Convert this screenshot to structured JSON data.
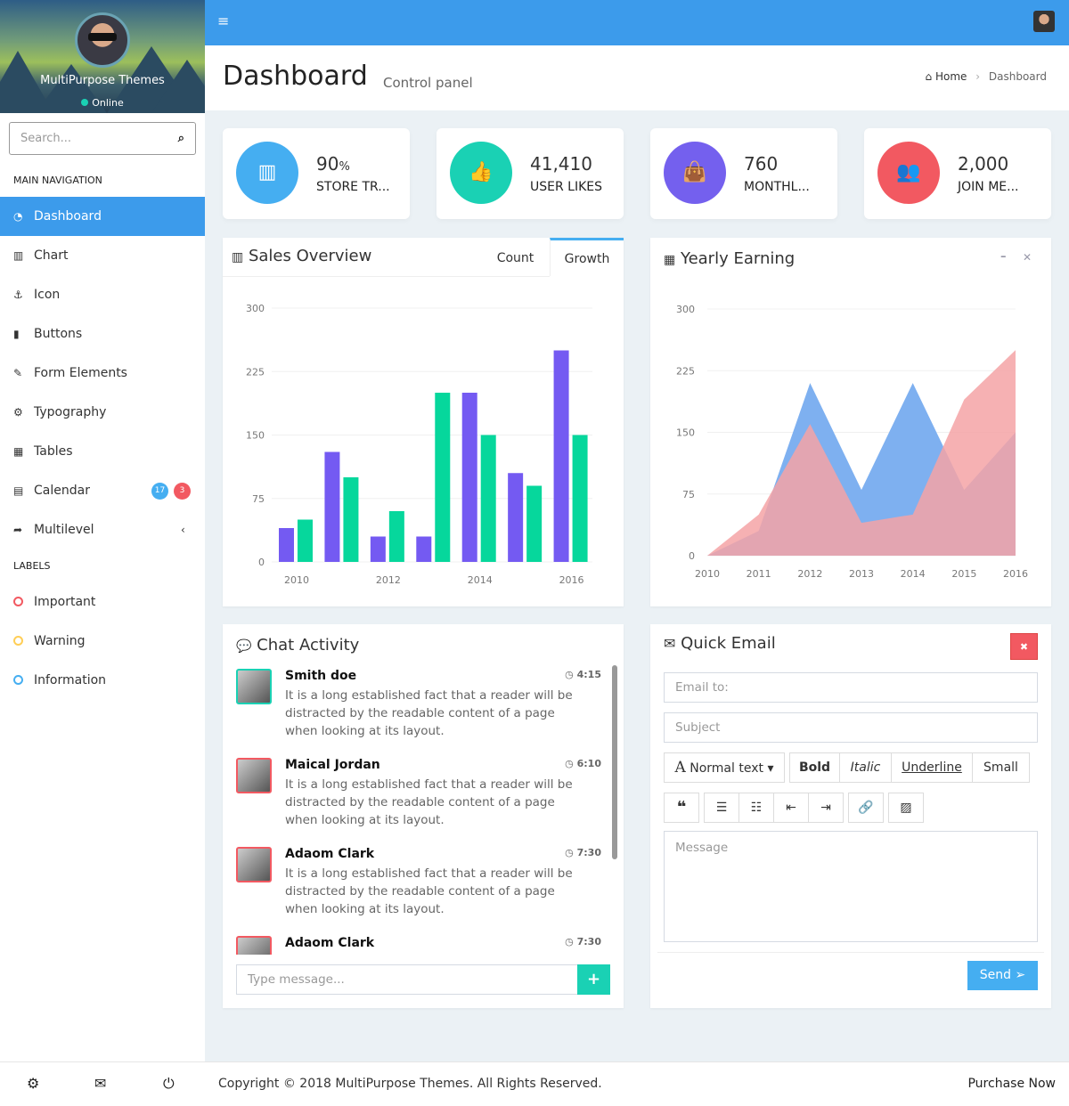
{
  "sidebar": {
    "user_name": "MultiPurpose Themes",
    "status": "Online",
    "search_placeholder": "Search...",
    "main_nav_label": "MAIN NAVIGATION",
    "labels_label": "LABELS",
    "items": [
      {
        "label": "Dashboard",
        "icon": "dashboard-icon",
        "active": true
      },
      {
        "label": "Chart",
        "icon": "bar-chart-icon"
      },
      {
        "label": "Icon",
        "icon": "anchor-icon"
      },
      {
        "label": "Buttons",
        "icon": "bookmark-icon"
      },
      {
        "label": "Form Elements",
        "icon": "edit-icon"
      },
      {
        "label": "Typography",
        "icon": "cogs-icon"
      },
      {
        "label": "Tables",
        "icon": "table-icon"
      },
      {
        "label": "Calendar",
        "icon": "calendar-icon",
        "badges": [
          "17",
          "3"
        ]
      },
      {
        "label": "Multilevel",
        "icon": "share-icon"
      }
    ],
    "labels": [
      {
        "label": "Important",
        "color": "#f25961"
      },
      {
        "label": "Warning",
        "color": "#ffce56"
      },
      {
        "label": "Information",
        "color": "#45aef1"
      }
    ],
    "footer_icons": [
      "gear-icon",
      "envelope-icon",
      "power-icon"
    ]
  },
  "header": {
    "title": "Dashboard",
    "subtitle": "Control panel",
    "breadcrumb": [
      "Home",
      "Dashboard"
    ]
  },
  "stats": [
    {
      "value": "90",
      "unit": "%",
      "label": "STORE TR...",
      "color": "#45aef1",
      "icon": "bar-chart-icon"
    },
    {
      "value": "41,410",
      "label": "USER LIKES",
      "color": "#1ad1b4",
      "icon": "thumbs-up-icon"
    },
    {
      "value": "760",
      "label": "MONTHL...",
      "color": "#7460ee",
      "icon": "shopping-bag-icon"
    },
    {
      "value": "2,000",
      "label": "JOIN ME...",
      "color": "#f25961",
      "icon": "users-icon"
    }
  ],
  "sales": {
    "title": "Sales Overview",
    "tabs": [
      "Count",
      "Growth"
    ],
    "active_tab": "Growth"
  },
  "yearly": {
    "title": "Yearly Earning"
  },
  "chart_data": [
    {
      "type": "bar",
      "categories": [
        "2010",
        "2011",
        "2012",
        "2013",
        "2014",
        "2015",
        "2016"
      ],
      "xtick_labels": [
        "2010",
        "2012",
        "2014",
        "2016"
      ],
      "yticks": [
        0,
        75,
        150,
        225,
        300
      ],
      "ylim": [
        0,
        300
      ],
      "grid": true,
      "series": [
        {
          "color": "#745af2",
          "values": [
            40,
            130,
            30,
            30,
            200,
            105,
            250
          ]
        },
        {
          "color": "#06d79c",
          "values": [
            50,
            100,
            60,
            200,
            150,
            90,
            150
          ]
        }
      ]
    },
    {
      "type": "area",
      "categories": [
        "2010",
        "2011",
        "2012",
        "2013",
        "2014",
        "2015",
        "2016"
      ],
      "yticks": [
        0,
        75,
        150,
        225,
        300
      ],
      "ylim": [
        0,
        300
      ],
      "grid": true,
      "series": [
        {
          "color": "#7eb0f0",
          "values": [
            0,
            30,
            210,
            80,
            210,
            80,
            150
          ]
        },
        {
          "color": "#f4a3a6",
          "values": [
            0,
            50,
            160,
            40,
            50,
            190,
            250
          ]
        }
      ]
    }
  ],
  "chat": {
    "title": "Chat Activity",
    "placeholder": "Type message...",
    "messages": [
      {
        "name": "Smith doe",
        "time": "4:15",
        "text": "It is a long established fact that a reader will be distracted by the readable content of a page when looking at its layout.",
        "border": "#1ad1b4"
      },
      {
        "name": "Maical Jordan",
        "time": "6:10",
        "text": "It is a long established fact that a reader will be distracted by the readable content of a page when looking at its layout.",
        "border": "#f25961"
      },
      {
        "name": "Adaom Clark",
        "time": "7:30",
        "text": "It is a long established fact that a reader will be distracted by the readable content of a page when looking at its layout.",
        "border": "#f25961"
      },
      {
        "name": "Adaom Clark",
        "time": "7:30",
        "text": "",
        "border": "#f25961"
      }
    ]
  },
  "email": {
    "title": "Quick Email",
    "to_placeholder": "Email to:",
    "subject_placeholder": "Subject",
    "message_placeholder": "Message",
    "format_label": "Normal text",
    "styles": [
      "Bold",
      "Italic",
      "Underline",
      "Small"
    ],
    "send_label": "Send"
  },
  "footer": {
    "copyright": "Copyright © 2018 MultiPurpose Themes. All Rights Reserved.",
    "purchase": "Purchase Now"
  }
}
